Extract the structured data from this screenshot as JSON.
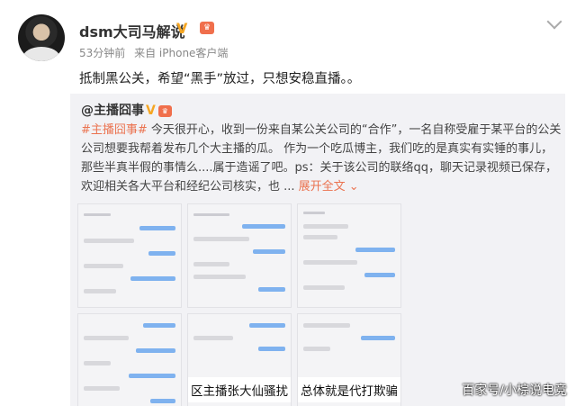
{
  "post": {
    "author": "dsm大司马解说",
    "verified_badge": "V",
    "crown_icon": "crown-icon",
    "crown_text": "🎁",
    "time": "53分钟前",
    "source": "来自 iPhone客户端",
    "text": "抵制黑公关，希望“黑手”放过，只想安稳直播。。"
  },
  "repost": {
    "author": "@主播囧事",
    "verified_badge": "V",
    "crown_text": "🎁",
    "tag": "#主播囧事#",
    "body": " 今天很开心，收到一份来自某公关公司的“合作”，一名自称受雇于某平台的公关公司想要我帮着发布几个大主播的瓜。 作为一个吃瓜博主，我们吃的是真实有实锤的事儿，那些半真半假的事情么....属于造谣了吧。ps：关于该公司的联络qq，聊天记录视频已保存，欢迎相关各大平台和经纪公司核实，也 ...",
    "more": "展开全文 ⌄",
    "thumbnail_captions": [
      "区主播张大仙骚扰",
      "总体就是代打欺骗"
    ]
  },
  "watermark": "百家号/小棕说电竞",
  "colors": {
    "link": "#eb7350",
    "badge": "#f5a623",
    "repost_bg": "#f2f2f5"
  }
}
